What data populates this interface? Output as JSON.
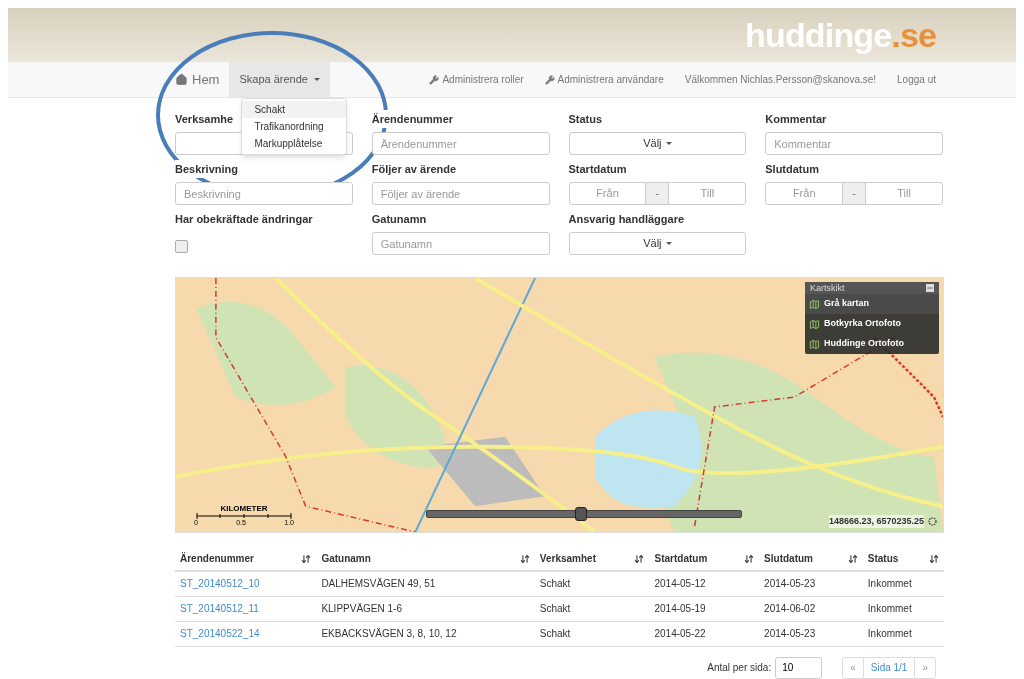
{
  "header": {
    "logo": {
      "name": "huddinge",
      "suffix": ".se"
    }
  },
  "nav": {
    "left": [
      {
        "kind": "home",
        "label": "Hem",
        "selected": false
      },
      {
        "kind": "dropdown",
        "label": "Skapa ärende",
        "selected": true,
        "expanded": true
      }
    ],
    "menu": [
      {
        "label": "Schakt",
        "selected": true
      },
      {
        "label": "Trafikanordning",
        "selected": false
      },
      {
        "label": "Markupplåtelse",
        "selected": false
      }
    ],
    "right": [
      {
        "kind": "wrench",
        "label": "Administrera roller"
      },
      {
        "kind": "wrench",
        "label": "Administrera användare"
      },
      {
        "kind": "text",
        "label": "Välkommen Nichlas.Persson@skanova.se!"
      },
      {
        "kind": "link",
        "label": "Logga ut"
      }
    ]
  },
  "filters": [
    {
      "kind": "text",
      "label": "Verksamhe"
    },
    {
      "kind": "text",
      "label": "Ärendenummer",
      "placeholder": "Ärendenummer"
    },
    {
      "kind": "select",
      "label": "Status",
      "value": "Välj"
    },
    {
      "kind": "text",
      "label": "Kommentar",
      "placeholder": "Kommentar"
    },
    {
      "kind": "text",
      "label": "Beskrivning",
      "placeholder": "Beskrivning"
    },
    {
      "kind": "text",
      "label": "Följer av ärende",
      "placeholder": "Följer av ärende"
    },
    {
      "kind": "daterange",
      "label": "Startdatum",
      "from": {
        "placeholder": "Från"
      },
      "sep": "-",
      "to": {
        "placeholder": "Till"
      }
    },
    {
      "kind": "daterange",
      "label": "Slutdatum",
      "from": {
        "placeholder": "Från"
      },
      "sep": "-",
      "to": {
        "placeholder": "Till"
      }
    },
    {
      "kind": "checkbox",
      "label": "Har obekräftade ändringar",
      "checked": false
    },
    {
      "kind": "text",
      "label": "Gatunamn",
      "placeholder": "Gatunamn"
    },
    {
      "kind": "select",
      "label": "Ansvarig handläggare",
      "value": "Välj"
    }
  ],
  "map": {
    "layers_title": "Kartskikt",
    "layers": [
      {
        "label": "Grå kartan",
        "selected": true
      },
      {
        "label": "Botkyrka Ortofoto",
        "selected": false
      },
      {
        "label": "Huddinge Ortofoto",
        "selected": false
      }
    ],
    "scale": {
      "title": "KILOMETER",
      "ticks": [
        "0",
        "0.5",
        "1.0"
      ]
    },
    "zoom": {
      "level": 0.49
    },
    "coordinates": "148666.23, 6570235.25"
  },
  "table": {
    "columns": [
      "Ärendenummer",
      "Gatunamn",
      "Verksamhet",
      "Startdatum",
      "Slutdatum",
      "Status"
    ],
    "rows": [
      [
        "ST_20140512_10",
        "DALHEMSVÄGEN 49, 51",
        "Schakt",
        "2014-05-12",
        "2014-05-23",
        "Inkommet"
      ],
      [
        "ST_20140512_11",
        "KLIPPVÄGEN 1-6",
        "Schakt",
        "2014-05-19",
        "2014-06-02",
        "Inkommet"
      ],
      [
        "ST_20140522_14",
        "EKBACKSVÄGEN 3, 8, 10, 12",
        "Schakt",
        "2014-05-22",
        "2014-05-23",
        "Inkommet"
      ]
    ]
  },
  "pagination": {
    "label": "Antal per sida:",
    "per_page": "10",
    "prev": "«",
    "page": "Sida 1/1",
    "next": "»"
  }
}
